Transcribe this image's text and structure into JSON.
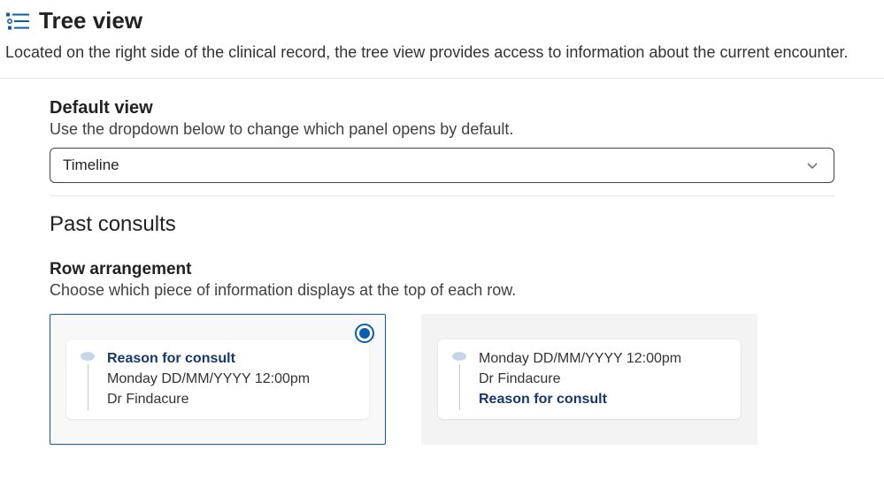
{
  "header": {
    "title": "Tree view",
    "description": "Located on the right side of the clinical record, the tree view provides access to information about the current encounter."
  },
  "defaultView": {
    "heading": "Default view",
    "hint": "Use the dropdown below to change which panel opens by default.",
    "selected": "Timeline"
  },
  "pastConsults": {
    "heading": "Past consults",
    "rowArrangement": {
      "heading": "Row arrangement",
      "hint": "Choose which piece of information displays at the top of each row.",
      "options": [
        {
          "selected": true,
          "line1": "Reason for consult",
          "line2": "Monday DD/MM/YYYY 12:00pm",
          "line3": "Dr Findacure",
          "emphasisLine": 1
        },
        {
          "selected": false,
          "line1": "Monday DD/MM/YYYY 12:00pm",
          "line2": "Dr Findacure",
          "line3": "Reason for consult",
          "emphasisLine": 3
        }
      ]
    }
  }
}
